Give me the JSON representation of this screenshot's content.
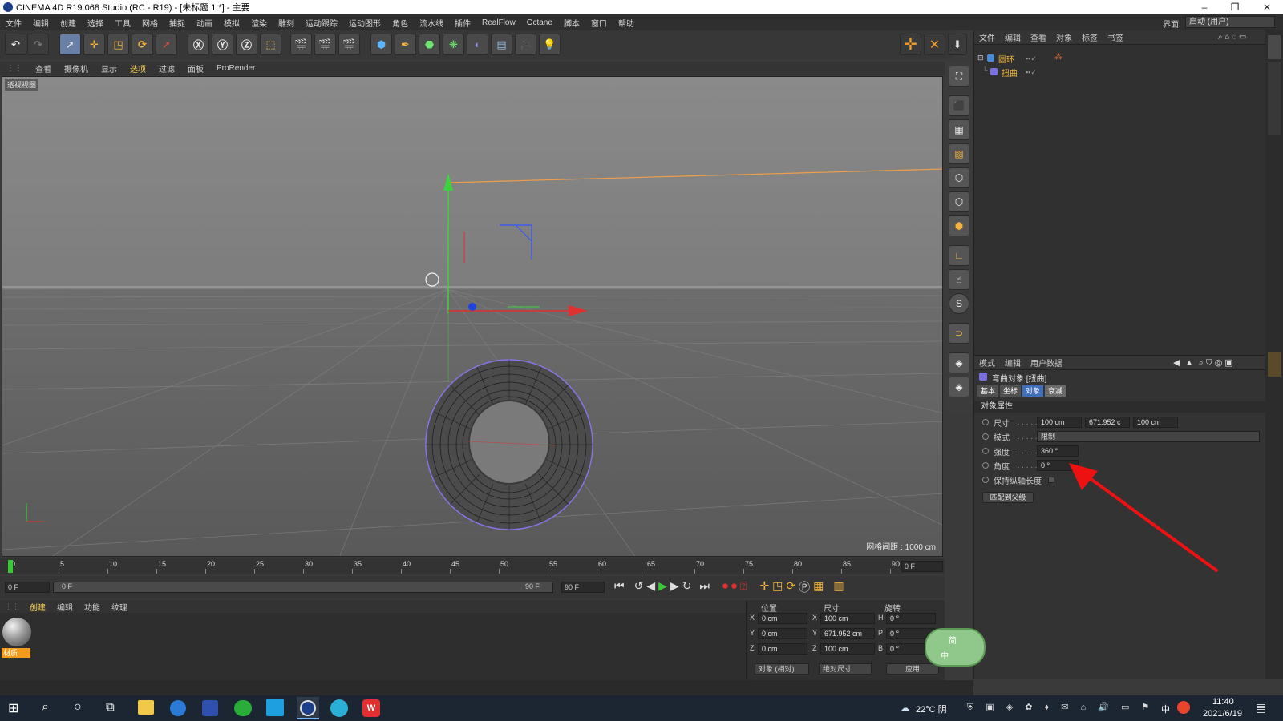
{
  "window": {
    "title": "CINEMA 4D R19.068 Studio (RC - R19) - [未标题 1 *] - 主要"
  },
  "menu": [
    "文件",
    "编辑",
    "创建",
    "选择",
    "工具",
    "网格",
    "捕捉",
    "动画",
    "模拟",
    "渲染",
    "雕刻",
    "运动跟踪",
    "运动图形",
    "角色",
    "流水线",
    "插件",
    "RealFlow",
    "Octane",
    "脚本",
    "窗口",
    "帮助"
  ],
  "layout": {
    "label": "界面:",
    "value": "启动 (用户)"
  },
  "viewport_menu": [
    "查看",
    "摄像机",
    "显示",
    "选项",
    "过滤",
    "面板",
    "ProRender"
  ],
  "viewport": {
    "label": "透视视图",
    "grid_info": "网格间距 : 1000 cm"
  },
  "object_manager": {
    "menu": [
      "文件",
      "编辑",
      "查看",
      "对象",
      "标签",
      "书签"
    ],
    "objects": [
      {
        "name": "圆环"
      },
      {
        "name": "扭曲"
      }
    ]
  },
  "attribute_manager": {
    "menu": [
      "模式",
      "编辑",
      "用户数据"
    ],
    "object_title": "弯曲对象 [扭曲]",
    "tabs": [
      "基本",
      "坐标",
      "对象",
      "衰减"
    ],
    "section": "对象属性",
    "props": {
      "size_label": "尺寸",
      "size_x": "100 cm",
      "size_y": "671.952 c",
      "size_z": "100 cm",
      "mode_label": "模式",
      "mode_value": "限制",
      "strength_label": "强度",
      "strength_value": "360 °",
      "angle_label": "角度",
      "angle_value": "0 °",
      "keep_label": "保持纵轴长度"
    },
    "fit_button": "匹配到父级"
  },
  "timeline": {
    "ticks": [
      "0",
      "5",
      "10",
      "15",
      "20",
      "25",
      "30",
      "35",
      "40",
      "45",
      "50",
      "55",
      "60",
      "65",
      "70",
      "75",
      "80",
      "85",
      "90"
    ],
    "current_frame": "0 F",
    "start": "0 F",
    "range_start": "0 F",
    "range_end": "90 F",
    "end": "90 F"
  },
  "material_manager": {
    "menu": [
      "创建",
      "编辑",
      "功能",
      "纹理"
    ],
    "material_name": "材质"
  },
  "coord_manager": {
    "headers": [
      "位置",
      "尺寸",
      "旋转"
    ],
    "rows": [
      {
        "axis": "X",
        "pos": "0 cm",
        "size_axis": "X",
        "size": "100 cm",
        "rot_axis": "H",
        "rot": "0 °"
      },
      {
        "axis": "Y",
        "pos": "0 cm",
        "size_axis": "Y",
        "size": "671.952 cm",
        "rot_axis": "P",
        "rot": "0 °"
      },
      {
        "axis": "Z",
        "pos": "0 cm",
        "size_axis": "Z",
        "size": "100 cm",
        "rot_axis": "B",
        "rot": "0 °"
      }
    ],
    "mode1": "对象 (相对)",
    "mode2": "绝对尺寸",
    "apply": "应用"
  },
  "ime": {
    "top": "简",
    "bottom": "中"
  },
  "taskbar": {
    "weather": "22°C 阴",
    "time": "11:40",
    "date": "2021/6/19",
    "ime": "中"
  }
}
